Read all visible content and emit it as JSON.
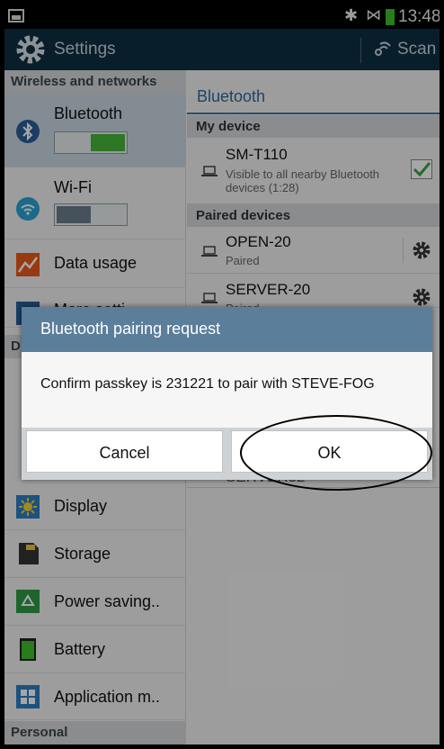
{
  "status_bar": {
    "time": "13:48",
    "bluetooth_icon": "bluetooth-icon",
    "signal_icon": "no-signal-icon",
    "battery_color": "#3fbf2a"
  },
  "action_bar": {
    "title": "Settings",
    "scan_label": "Scan"
  },
  "left_pane": {
    "header_wireless": "Wireless and networks",
    "items": {
      "bluetooth": "Bluetooth",
      "wifi": "Wi-Fi",
      "data_usage": "Data usage",
      "more_settings": "More setti...",
      "display": "Display",
      "storage": "Storage",
      "power_saving": "Power saving..",
      "battery": "Battery",
      "application_manager": "Application m.."
    },
    "section_d": "D",
    "header_personal": "Personal"
  },
  "right_pane": {
    "title": "Bluetooth",
    "my_device_header": "My device",
    "my_device": {
      "name": "SM-T110",
      "sub": "Visible to all nearby Bluetooth devices (1:28)",
      "checked": true
    },
    "paired_header": "Paired devices",
    "paired": [
      {
        "name": "OPEN-20",
        "status": "Paired"
      },
      {
        "name": "SERVER-20",
        "status": "Paired"
      }
    ],
    "available_partial": "SERVER32"
  },
  "dialog": {
    "title": "Bluetooth pairing request",
    "message": "Confirm passkey is 231221 to pair with STEVE-FOG",
    "cancel_label": "Cancel",
    "ok_label": "OK"
  },
  "colors": {
    "action_bar": "#0f2f42",
    "accent": "#2b6a9a",
    "dialog_header": "#5b7e9a",
    "selected_item": "#cad8e2"
  }
}
